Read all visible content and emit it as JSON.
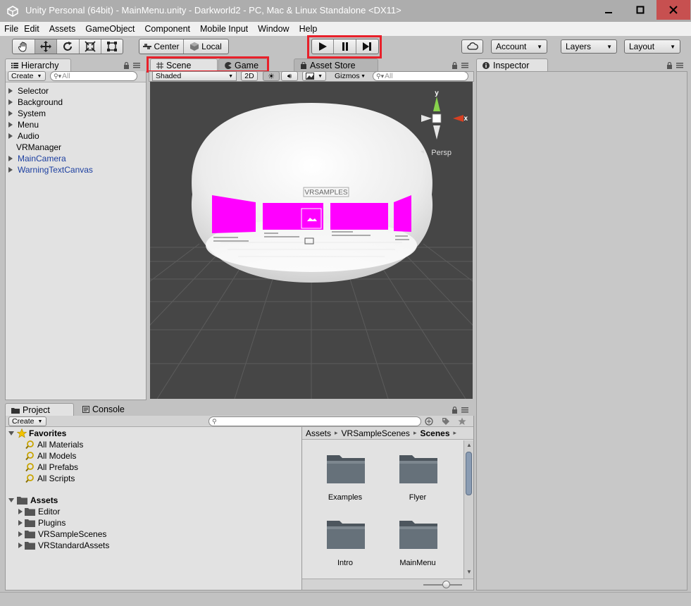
{
  "window": {
    "title": "Unity Personal (64bit) - MainMenu.unity - Darkworld2 - PC, Mac & Linux Standalone <DX11>"
  },
  "menubar": {
    "items": [
      "File",
      "Edit",
      "Assets",
      "GameObject",
      "Component",
      "Mobile Input",
      "Window",
      "Help"
    ]
  },
  "toolbar": {
    "pivot_label": "Center",
    "space_label": "Local",
    "account_label": "Account",
    "layers_label": "Layers",
    "layout_label": "Layout"
  },
  "hierarchy": {
    "tab_label": "Hierarchy",
    "create_label": "Create",
    "search_placeholder": "All",
    "items": [
      {
        "label": "Selector",
        "expandable": true,
        "color": "#000000"
      },
      {
        "label": "Background",
        "expandable": true,
        "color": "#000000"
      },
      {
        "label": "System",
        "expandable": true,
        "color": "#000000"
      },
      {
        "label": "Menu",
        "expandable": true,
        "color": "#000000"
      },
      {
        "label": "Audio",
        "expandable": true,
        "color": "#000000"
      },
      {
        "label": "VRManager",
        "expandable": false,
        "color": "#000000"
      },
      {
        "label": "MainCamera",
        "expandable": true,
        "color": "#1c3fa0"
      },
      {
        "label": "WarningTextCanvas",
        "expandable": true,
        "color": "#1c3fa0"
      }
    ]
  },
  "scene": {
    "tab_scene": "Scene",
    "tab_game": "Game",
    "tab_asset_store": "Asset Store",
    "shading_label": "Shaded",
    "mode_2d": "2D",
    "gizmos_label": "Gizmos",
    "search_placeholder": "All",
    "axis_y": "y",
    "axis_x": "x",
    "persp_label": "Persp",
    "logo_text": "VRSAMPLES"
  },
  "inspector": {
    "tab_label": "Inspector"
  },
  "project": {
    "tab_project": "Project",
    "tab_console": "Console",
    "create_label": "Create",
    "favorites_label": "Favorites",
    "favorites": [
      "All Materials",
      "All Models",
      "All Prefabs",
      "All Scripts"
    ],
    "assets_label": "Assets",
    "asset_folders": [
      "Editor",
      "Plugins",
      "VRSampleScenes",
      "VRStandardAssets"
    ],
    "breadcrumb": [
      "Assets",
      "VRSampleScenes",
      "Scenes"
    ],
    "grid_folders": [
      "Examples",
      "Flyer",
      "Intro",
      "MainMenu"
    ]
  },
  "colors": {
    "highlight_red": "#e8202a",
    "title_bar": "#adadad",
    "close_button": "#c75050",
    "magenta_panels": "#ff00ff",
    "scene_background": "#464646"
  }
}
